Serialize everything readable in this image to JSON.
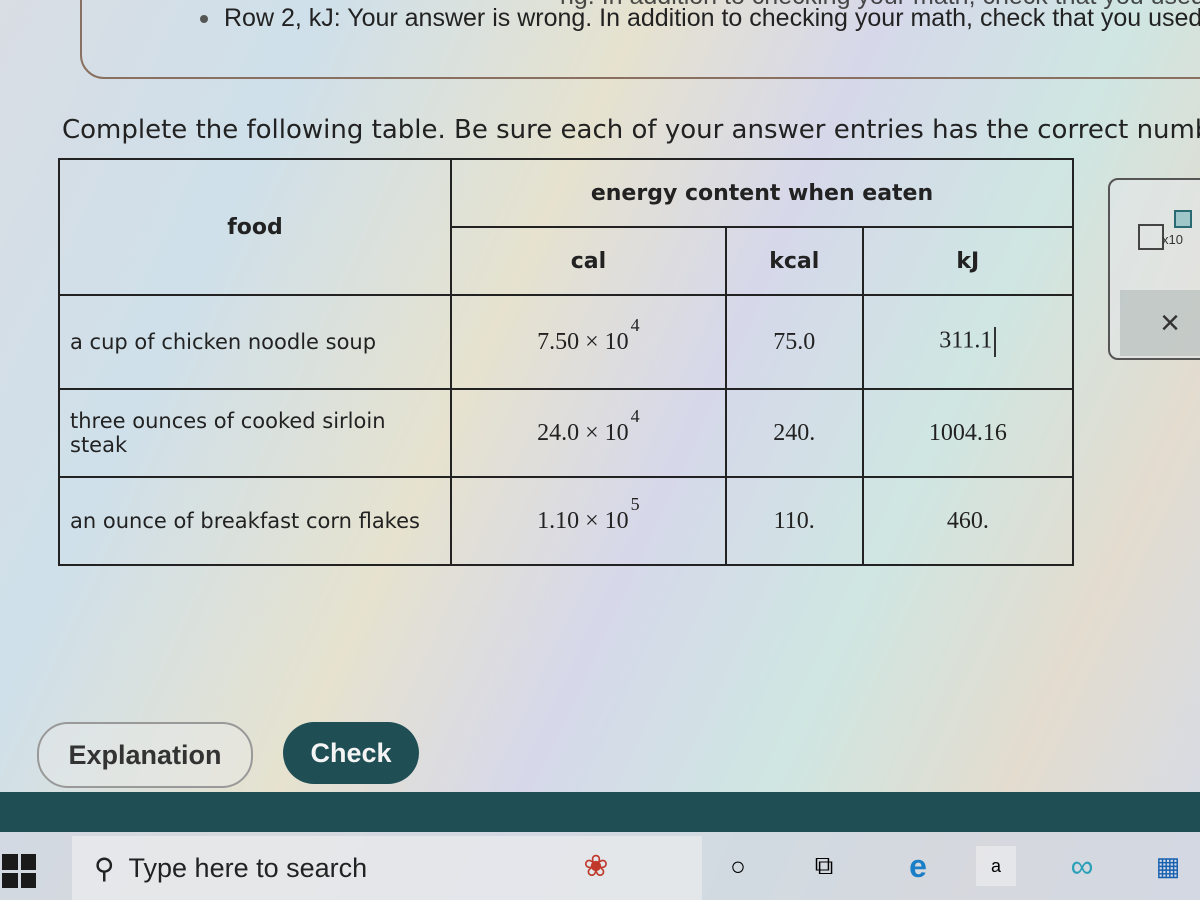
{
  "feedback": {
    "ghost_line": "ng. In addition to checking your math, check that you used t",
    "main_line": "Row 2, kJ: Your answer is wrong. In addition to checking your math, check that you used"
  },
  "instruction": "Complete the following table. Be sure each of your answer entries has the correct number",
  "table": {
    "food_header": "food",
    "energy_header": "energy content when eaten",
    "units": [
      "cal",
      "kcal",
      "kJ"
    ],
    "rows": [
      {
        "food": "a cup of chicken noodle soup",
        "cal_mantissa": "7.50 × 10",
        "cal_exp": "4",
        "kcal": "75.0",
        "kJ": "311.1"
      },
      {
        "food": "three ounces of cooked sirloin steak",
        "cal_mantissa": "24.0 × 10",
        "cal_exp": "4",
        "kcal": "240.",
        "kJ": "1004.16"
      },
      {
        "food": "an ounce of breakfast corn flakes",
        "cal_mantissa": "1.10 × 10",
        "cal_exp": "5",
        "kcal": "110.",
        "kJ": "460."
      }
    ]
  },
  "side_panel": {
    "sci_label": "x10",
    "close_symbol": "×"
  },
  "buttons": {
    "explanation": "Explanation",
    "check": "Check"
  },
  "taskbar": {
    "search_placeholder": "Type here to search",
    "icons": {
      "cortana": "○",
      "taskview": "⧉",
      "edge": "e",
      "amazon": "a",
      "infinity": "∞",
      "store": "▦"
    }
  }
}
